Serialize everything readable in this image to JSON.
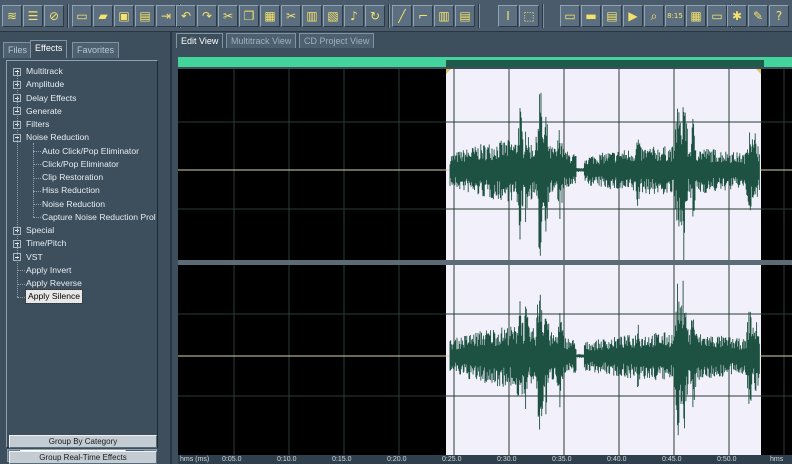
{
  "toolbar": {
    "buttons": [
      "waveform-multitrack-toggle-icon",
      "cd-view-icon",
      "no-entry-icon",
      "new-file-icon",
      "open-folder-icon",
      "save-icon",
      "save-as-icon",
      "exit-icon",
      "undo-icon",
      "redo-icon",
      "cut-icon",
      "copy-icon",
      "paste-icon",
      "scissors-icon",
      "paste-new-icon",
      "mix-paste-icon",
      "sound-icon",
      "loop-icon",
      "pen-icon",
      "envelope-icon",
      "bars-icon",
      "selection-icon",
      "cursor-icon",
      "marquee-icon",
      "spectral-icon",
      "waveform-view-icon",
      "transport-icon",
      "play-icon",
      "zoom-icon",
      "time-icon",
      "levels-icon",
      "status-icon",
      "settings-icon",
      "edit-icon",
      "help-icon"
    ],
    "time_button_text": "8:15"
  },
  "left_panel": {
    "tabs": [
      "Files",
      "Effects",
      "Favorites"
    ],
    "active_tab": "Effects",
    "tree": [
      {
        "label": "Multitrack",
        "level": 0,
        "expander": "plus"
      },
      {
        "label": "Amplitude",
        "level": 0,
        "expander": "plus"
      },
      {
        "label": "Delay Effects",
        "level": 0,
        "expander": "plus"
      },
      {
        "label": "Generate",
        "level": 0,
        "expander": "plus"
      },
      {
        "label": "Filters",
        "level": 0,
        "expander": "plus"
      },
      {
        "label": "Noise Reduction",
        "level": 0,
        "expander": "minus"
      },
      {
        "label": "Auto Click/Pop Eliminator",
        "level": 1
      },
      {
        "label": "Click/Pop Eliminator",
        "level": 1
      },
      {
        "label": "Clip Restoration",
        "level": 1
      },
      {
        "label": "Hiss Reduction",
        "level": 1
      },
      {
        "label": "Noise Reduction",
        "level": 1
      },
      {
        "label": "Capture Noise Reduction Prol",
        "level": 1
      },
      {
        "label": "Special",
        "level": 0,
        "expander": "plus"
      },
      {
        "label": "Time/Pitch",
        "level": 0,
        "expander": "plus"
      },
      {
        "label": "VST",
        "level": 0,
        "expander": "minus"
      },
      {
        "label": "Apply Invert",
        "level": 0
      },
      {
        "label": "Apply Reverse",
        "level": 0
      },
      {
        "label": "Apply Silence",
        "level": 0,
        "selected": true
      }
    ],
    "group_by_category": "Group By Category",
    "group_realtime": "Group Real-Time Effects"
  },
  "view_tabs": [
    "Edit View",
    "Multitrack View",
    "CD Project View"
  ],
  "active_view": "Edit View",
  "ruler": {
    "labels": [
      "hms (ms)",
      "0:05.0",
      "0:10.0",
      "0:15.0",
      "0:20.0",
      "0:25.0",
      "0:30.0",
      "0:35.0",
      "0:40.0",
      "0:45.0",
      "0:50.0",
      "hms"
    ]
  },
  "colors": {
    "waveform": "#1d5242",
    "selection_bg": "#f2f0fa",
    "overview": "#42d49a"
  }
}
